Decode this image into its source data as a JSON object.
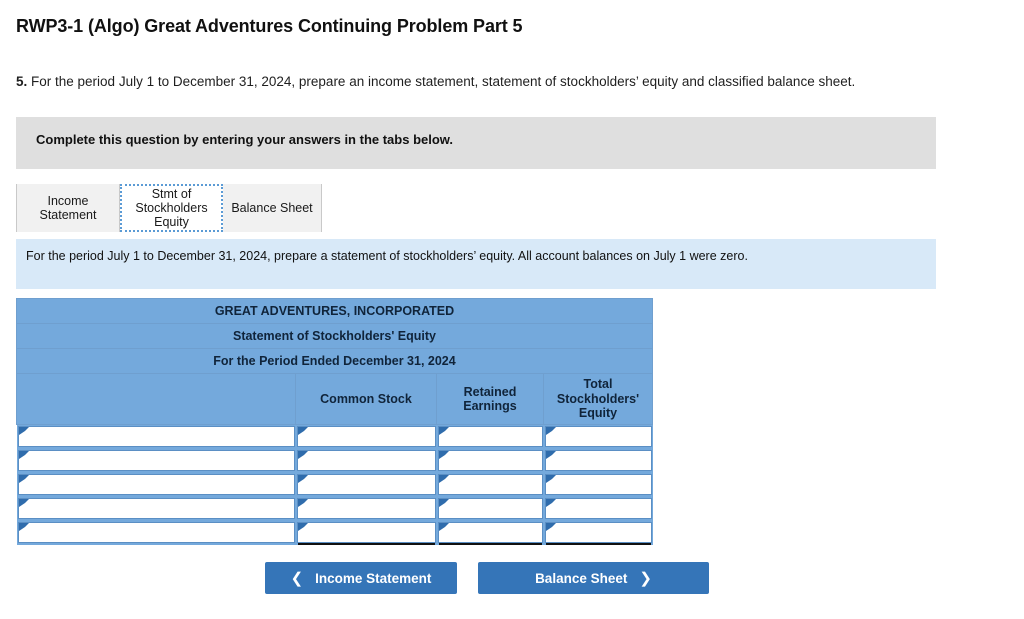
{
  "page_title": "RWP3-1 (Algo) Great Adventures Continuing Problem Part 5",
  "prompt": {
    "number": "5.",
    "text": " For the period July 1 to December 31, 2024, prepare an income statement, statement of stockholders’ equity and classified balance sheet."
  },
  "complete_bar": {
    "text": "Complete this question by entering your answers in the tabs below."
  },
  "tabs": [
    {
      "label": "Income Statement",
      "name": "tab-income-statement",
      "active": false
    },
    {
      "label": "Stmt of Stockholders Equity",
      "name": "tab-stmt-stockholders-equity",
      "active": true
    },
    {
      "label": "Balance Sheet",
      "name": "tab-balance-sheet",
      "active": false
    }
  ],
  "sub_instruction": {
    "text": "For the period July 1 to December 31, 2024, prepare a statement of stockholders’ equity. All account balances on July 1 were zero."
  },
  "statement": {
    "company": "GREAT ADVENTURES, INCORPORATED",
    "title": "Statement of Stockholders' Equity",
    "period": "For the Period Ended December 31, 2024",
    "columns": [
      "",
      "Common Stock",
      "Retained Earnings",
      "Total Stockholders' Equity"
    ],
    "rows": [
      {
        "label": "",
        "common_stock": "",
        "retained_earnings": "",
        "total": ""
      },
      {
        "label": "",
        "common_stock": "",
        "retained_earnings": "",
        "total": ""
      },
      {
        "label": "",
        "common_stock": "",
        "retained_earnings": "",
        "total": ""
      },
      {
        "label": "",
        "common_stock": "",
        "retained_earnings": "",
        "total": ""
      },
      {
        "label": "",
        "common_stock": "",
        "retained_earnings": "",
        "total": ""
      }
    ]
  },
  "navigation": {
    "prev_label": "Income Statement",
    "prev_icon": "chevron-left-icon",
    "next_label": "Balance Sheet",
    "next_icon": "chevron-right-icon"
  },
  "colors": {
    "table_header_blue": "#74a9dc",
    "button_blue": "#3575b8",
    "instruction_gray": "#dfdfdf",
    "sub_instruction_blue": "#d8e9f8",
    "cell_border_blue": "#5b8fc4",
    "marker_blue": "#2f6cac"
  }
}
